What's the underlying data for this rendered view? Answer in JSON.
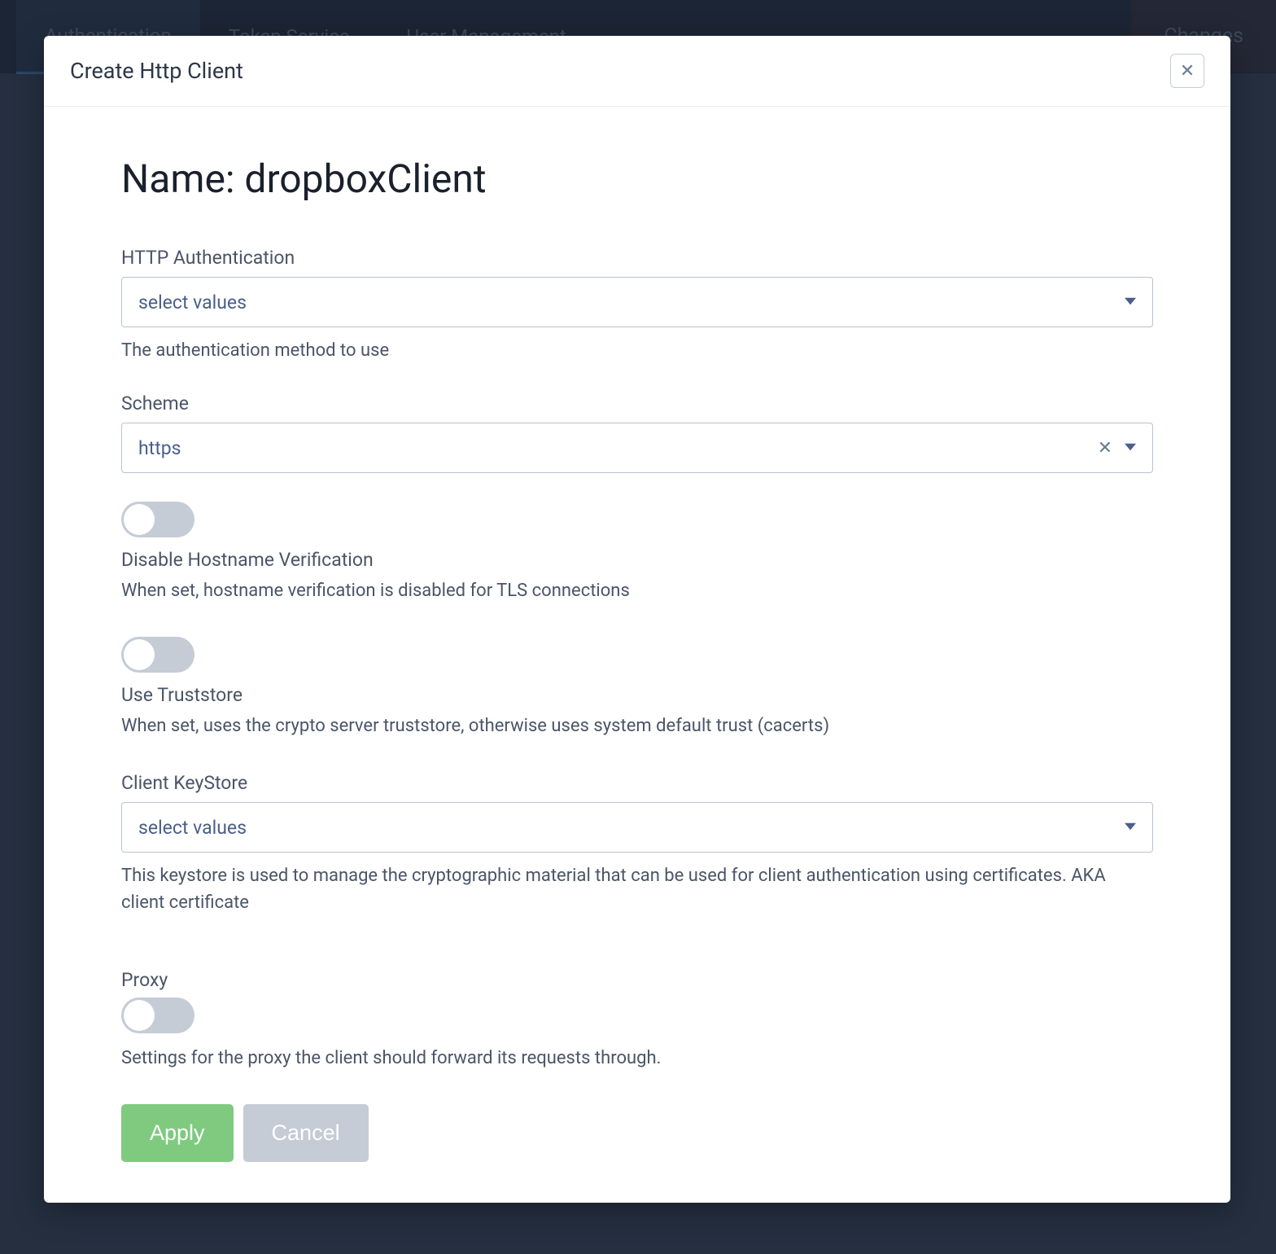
{
  "background": {
    "tabs": {
      "authentication": "Authentication",
      "tokenService": "Token Service",
      "userManagement": "User Management"
    },
    "changesButton": "Changes"
  },
  "modal": {
    "title": "Create Http Client",
    "nameLabel": "Name: dropboxClient",
    "fields": {
      "httpAuth": {
        "label": "HTTP Authentication",
        "placeholder": "select values",
        "help": "The authentication method to use"
      },
      "scheme": {
        "label": "Scheme",
        "value": "https"
      },
      "disableHostname": {
        "label": "Disable Hostname Verification",
        "help": "When set, hostname verification is disabled for TLS connections"
      },
      "useTruststore": {
        "label": "Use Truststore",
        "help": "When set, uses the crypto server truststore, otherwise uses system default trust (cacerts)"
      },
      "clientKeystore": {
        "label": "Client KeyStore",
        "placeholder": "select values",
        "help": "This keystore is used to manage the cryptographic material that can be used for client authentication using certificates. AKA client certificate"
      },
      "proxy": {
        "label": "Proxy",
        "help": "Settings for the proxy the client should forward its requests through."
      }
    },
    "buttons": {
      "apply": "Apply",
      "cancel": "Cancel"
    }
  }
}
